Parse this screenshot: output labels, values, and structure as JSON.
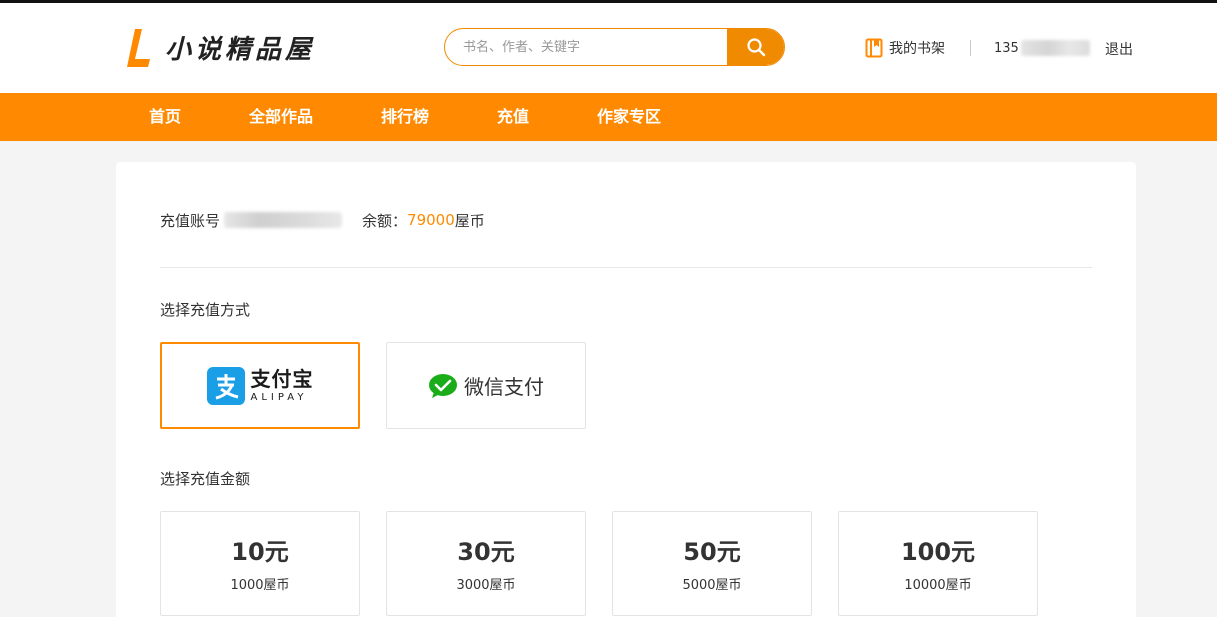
{
  "header": {
    "logo_text": "小说精品屋",
    "search_placeholder": "书名、作者、关键字",
    "shelf_label": "我的书架",
    "user_prefix": "135",
    "logout_label": "退出"
  },
  "nav": {
    "items": [
      {
        "label": "首页"
      },
      {
        "label": "全部作品"
      },
      {
        "label": "排行榜"
      },
      {
        "label": "充值"
      },
      {
        "label": "作家专区"
      }
    ]
  },
  "account": {
    "label": "充值账号",
    "balance_label": "余额：",
    "balance_value": "79000",
    "balance_unit": "屋币"
  },
  "payment": {
    "section_label": "选择充值方式",
    "alipay_cn": "支付宝",
    "alipay_en": "ALIPAY",
    "wechat_label": "微信支付",
    "selected": "alipay"
  },
  "amounts": {
    "section_label": "选择充值金额",
    "options": [
      {
        "main": "10元",
        "sub": "1000屋币"
      },
      {
        "main": "30元",
        "sub": "3000屋币"
      },
      {
        "main": "50元",
        "sub": "5000屋币"
      },
      {
        "main": "100元",
        "sub": "10000屋币"
      }
    ]
  },
  "colors": {
    "accent": "#ff8900",
    "alipay_blue": "#1a9fe6",
    "wechat_green": "#1aad19"
  }
}
